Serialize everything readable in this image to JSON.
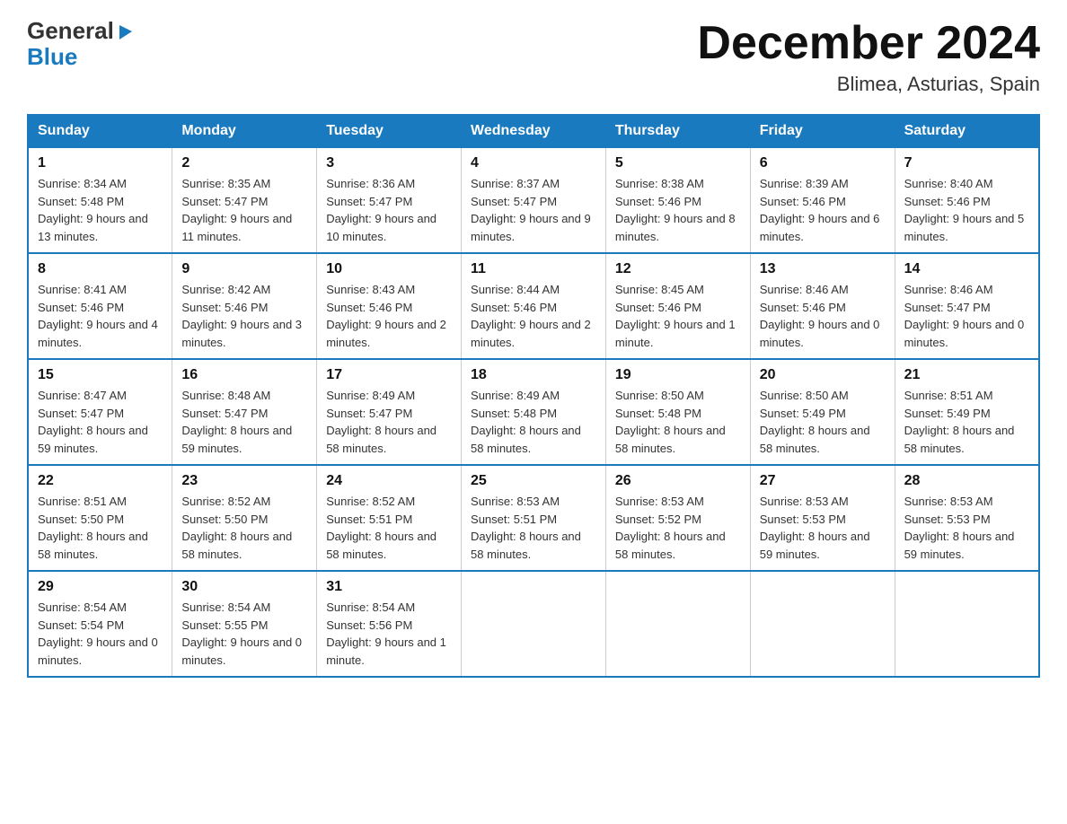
{
  "logo": {
    "general": "General",
    "blue": "Blue",
    "triangle": "▶"
  },
  "header": {
    "month_year": "December 2024",
    "location": "Blimea, Asturias, Spain"
  },
  "weekdays": [
    "Sunday",
    "Monday",
    "Tuesday",
    "Wednesday",
    "Thursday",
    "Friday",
    "Saturday"
  ],
  "weeks": [
    [
      {
        "day": "1",
        "sunrise": "Sunrise: 8:34 AM",
        "sunset": "Sunset: 5:48 PM",
        "daylight": "Daylight: 9 hours and 13 minutes."
      },
      {
        "day": "2",
        "sunrise": "Sunrise: 8:35 AM",
        "sunset": "Sunset: 5:47 PM",
        "daylight": "Daylight: 9 hours and 11 minutes."
      },
      {
        "day": "3",
        "sunrise": "Sunrise: 8:36 AM",
        "sunset": "Sunset: 5:47 PM",
        "daylight": "Daylight: 9 hours and 10 minutes."
      },
      {
        "day": "4",
        "sunrise": "Sunrise: 8:37 AM",
        "sunset": "Sunset: 5:47 PM",
        "daylight": "Daylight: 9 hours and 9 minutes."
      },
      {
        "day": "5",
        "sunrise": "Sunrise: 8:38 AM",
        "sunset": "Sunset: 5:46 PM",
        "daylight": "Daylight: 9 hours and 8 minutes."
      },
      {
        "day": "6",
        "sunrise": "Sunrise: 8:39 AM",
        "sunset": "Sunset: 5:46 PM",
        "daylight": "Daylight: 9 hours and 6 minutes."
      },
      {
        "day": "7",
        "sunrise": "Sunrise: 8:40 AM",
        "sunset": "Sunset: 5:46 PM",
        "daylight": "Daylight: 9 hours and 5 minutes."
      }
    ],
    [
      {
        "day": "8",
        "sunrise": "Sunrise: 8:41 AM",
        "sunset": "Sunset: 5:46 PM",
        "daylight": "Daylight: 9 hours and 4 minutes."
      },
      {
        "day": "9",
        "sunrise": "Sunrise: 8:42 AM",
        "sunset": "Sunset: 5:46 PM",
        "daylight": "Daylight: 9 hours and 3 minutes."
      },
      {
        "day": "10",
        "sunrise": "Sunrise: 8:43 AM",
        "sunset": "Sunset: 5:46 PM",
        "daylight": "Daylight: 9 hours and 2 minutes."
      },
      {
        "day": "11",
        "sunrise": "Sunrise: 8:44 AM",
        "sunset": "Sunset: 5:46 PM",
        "daylight": "Daylight: 9 hours and 2 minutes."
      },
      {
        "day": "12",
        "sunrise": "Sunrise: 8:45 AM",
        "sunset": "Sunset: 5:46 PM",
        "daylight": "Daylight: 9 hours and 1 minute."
      },
      {
        "day": "13",
        "sunrise": "Sunrise: 8:46 AM",
        "sunset": "Sunset: 5:46 PM",
        "daylight": "Daylight: 9 hours and 0 minutes."
      },
      {
        "day": "14",
        "sunrise": "Sunrise: 8:46 AM",
        "sunset": "Sunset: 5:47 PM",
        "daylight": "Daylight: 9 hours and 0 minutes."
      }
    ],
    [
      {
        "day": "15",
        "sunrise": "Sunrise: 8:47 AM",
        "sunset": "Sunset: 5:47 PM",
        "daylight": "Daylight: 8 hours and 59 minutes."
      },
      {
        "day": "16",
        "sunrise": "Sunrise: 8:48 AM",
        "sunset": "Sunset: 5:47 PM",
        "daylight": "Daylight: 8 hours and 59 minutes."
      },
      {
        "day": "17",
        "sunrise": "Sunrise: 8:49 AM",
        "sunset": "Sunset: 5:47 PM",
        "daylight": "Daylight: 8 hours and 58 minutes."
      },
      {
        "day": "18",
        "sunrise": "Sunrise: 8:49 AM",
        "sunset": "Sunset: 5:48 PM",
        "daylight": "Daylight: 8 hours and 58 minutes."
      },
      {
        "day": "19",
        "sunrise": "Sunrise: 8:50 AM",
        "sunset": "Sunset: 5:48 PM",
        "daylight": "Daylight: 8 hours and 58 minutes."
      },
      {
        "day": "20",
        "sunrise": "Sunrise: 8:50 AM",
        "sunset": "Sunset: 5:49 PM",
        "daylight": "Daylight: 8 hours and 58 minutes."
      },
      {
        "day": "21",
        "sunrise": "Sunrise: 8:51 AM",
        "sunset": "Sunset: 5:49 PM",
        "daylight": "Daylight: 8 hours and 58 minutes."
      }
    ],
    [
      {
        "day": "22",
        "sunrise": "Sunrise: 8:51 AM",
        "sunset": "Sunset: 5:50 PM",
        "daylight": "Daylight: 8 hours and 58 minutes."
      },
      {
        "day": "23",
        "sunrise": "Sunrise: 8:52 AM",
        "sunset": "Sunset: 5:50 PM",
        "daylight": "Daylight: 8 hours and 58 minutes."
      },
      {
        "day": "24",
        "sunrise": "Sunrise: 8:52 AM",
        "sunset": "Sunset: 5:51 PM",
        "daylight": "Daylight: 8 hours and 58 minutes."
      },
      {
        "day": "25",
        "sunrise": "Sunrise: 8:53 AM",
        "sunset": "Sunset: 5:51 PM",
        "daylight": "Daylight: 8 hours and 58 minutes."
      },
      {
        "day": "26",
        "sunrise": "Sunrise: 8:53 AM",
        "sunset": "Sunset: 5:52 PM",
        "daylight": "Daylight: 8 hours and 58 minutes."
      },
      {
        "day": "27",
        "sunrise": "Sunrise: 8:53 AM",
        "sunset": "Sunset: 5:53 PM",
        "daylight": "Daylight: 8 hours and 59 minutes."
      },
      {
        "day": "28",
        "sunrise": "Sunrise: 8:53 AM",
        "sunset": "Sunset: 5:53 PM",
        "daylight": "Daylight: 8 hours and 59 minutes."
      }
    ],
    [
      {
        "day": "29",
        "sunrise": "Sunrise: 8:54 AM",
        "sunset": "Sunset: 5:54 PM",
        "daylight": "Daylight: 9 hours and 0 minutes."
      },
      {
        "day": "30",
        "sunrise": "Sunrise: 8:54 AM",
        "sunset": "Sunset: 5:55 PM",
        "daylight": "Daylight: 9 hours and 0 minutes."
      },
      {
        "day": "31",
        "sunrise": "Sunrise: 8:54 AM",
        "sunset": "Sunset: 5:56 PM",
        "daylight": "Daylight: 9 hours and 1 minute."
      },
      null,
      null,
      null,
      null
    ]
  ]
}
